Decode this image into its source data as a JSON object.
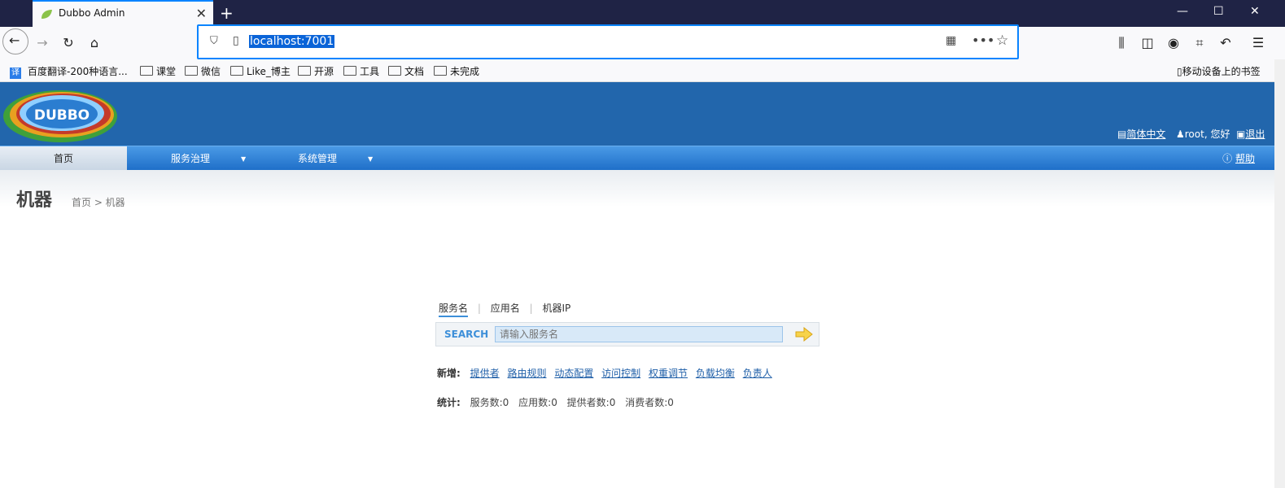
{
  "browser": {
    "tab_title": "Dubbo Admin",
    "url": "localhost:7001",
    "bookmarks": [
      {
        "label": "百度翻译-200种语言..."
      },
      {
        "label": "课堂"
      },
      {
        "label": "微信"
      },
      {
        "label": "Like_博主"
      },
      {
        "label": "开源"
      },
      {
        "label": "工具"
      },
      {
        "label": "文档"
      },
      {
        "label": "未完成"
      }
    ],
    "mobile_bookmarks": "移动设备上的书签"
  },
  "header": {
    "logo_text": "DUBBO",
    "language": "简体中文",
    "user_greeting": "root, 您好",
    "logout": "退出"
  },
  "menu": {
    "items": [
      {
        "label": "首页"
      },
      {
        "label": "服务治理"
      },
      {
        "label": "系统管理"
      }
    ],
    "help": "帮助"
  },
  "page": {
    "title": "机器",
    "breadcrumb": "首页 > 机器"
  },
  "search": {
    "tabs": [
      {
        "label": "服务名"
      },
      {
        "label": "应用名"
      },
      {
        "label": "机器IP"
      }
    ],
    "label": "SEARCH",
    "placeholder": "请输入服务名"
  },
  "add_links": {
    "label": "新增:",
    "items": [
      "提供者",
      "路由规则",
      "动态配置",
      "访问控制",
      "权重调节",
      "负载均衡",
      "负责人"
    ]
  },
  "stats": {
    "label": "统计:",
    "items": [
      "服务数:0",
      "应用数:0",
      "提供者数:0",
      "消费者数:0"
    ]
  },
  "colors": {
    "header_bg": "#2266ac",
    "menu_bg": "#1f6fc9",
    "link": "#1f5fa8",
    "accent": "#0a84ff"
  }
}
